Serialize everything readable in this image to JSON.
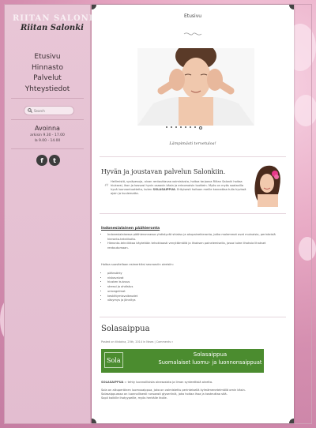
{
  "logo": {
    "ghost_text": "RIITAN SALONKI",
    "name": "Riitan Salonki"
  },
  "nav": {
    "items": [
      "Etusivu",
      "Hinnasto",
      "Palvelut",
      "Yhteystiedot"
    ]
  },
  "search": {
    "placeholder": "Search"
  },
  "hours": {
    "title": "Avoinna",
    "weekday": "arkisin 9.30 - 17.00",
    "saturday": "la 9.00 - 14.00"
  },
  "social": {
    "facebook": "f",
    "twitter": "t"
  },
  "page": {
    "title": "Etusivu"
  },
  "slider": {
    "caption": "Lämpimästi tervetuloa!",
    "slide_count": 8,
    "active_index": 7
  },
  "intro": {
    "heading": "Hyvän ja joustavan palvelun Salonkiin.",
    "paragraph1": "Hellimistä, syväpesuja, aivan rentouttavaa voimistusta, hoitoa tarjoava Riitan Salonki",
    "paragraph2": "hoitaa hiuksesi, ihon ja kasvosi hyvin osaavin käsin ja erinomaisin tuottein.",
    "paragraph3": "Myös on myös saatavilla hyvä luonnontuotteita, kuten ",
    "product_inline": "SOLASAIPPUA",
    "paragraph4": "Erityisesti hoitoon meille kannattaa tulla hyvissä ajoin ja kuulematta."
  },
  "massage": {
    "heading": "Indonesialainen päähieronta",
    "bullets": [
      "Indonesialaisessa päähieronnassa yhdistyvät shiatsu ja akupainehieronta, jotka molemmat ovat muinaisia, perinteisiä hieronta-tekniikoita.",
      "Hieronta-tekniikkaa käytetään tehokkaasti venyttämällä ja lihaksen painelemisella, jossa tulee lihaksia lihakset rentoutumaan."
    ],
    "lead": "Hoitoa suositellaan esimerkiksi seuraaviin oireisiin:",
    "symptoms": [
      "päänsärky",
      "niskavaivat",
      "hiusten kuivuus",
      "stressi ja ahdistus",
      "uniongelmat",
      "keskittymisvaikeudet",
      "väsymys ja jännitys"
    ]
  },
  "post": {
    "title": "Solasaippua",
    "meta": "Posted on tiistaina, 25th, 2014 in News  |  Comments »",
    "banner_logo": "Sola",
    "banner_title": "Solasaippua",
    "banner_tagline": "Suomalaiset luomu- ja luonnonsaippuat",
    "body_lead": "SOLASAIPPUA",
    "body1": " = tehty luonnollisista ainesosista ja ilman synteettisiä aineita.",
    "body2": "Sola on alkuperäinen luomusaippua, joka on valmistettu perinteisellä kylmämenetelmällä omin käsin.",
    "body3": "Solasaippuassa on luonnollisesti runsaasti glyseriiniä, joka hoitaa ihoa ja kosteuttaa sitä.",
    "body4": "Sopii kaikille ihotyypeille, myös herkälle iholle."
  },
  "colors": {
    "sidebar": "#e6c2d3",
    "accent_green": "#4b8c2f",
    "background": "#d58fb0"
  }
}
